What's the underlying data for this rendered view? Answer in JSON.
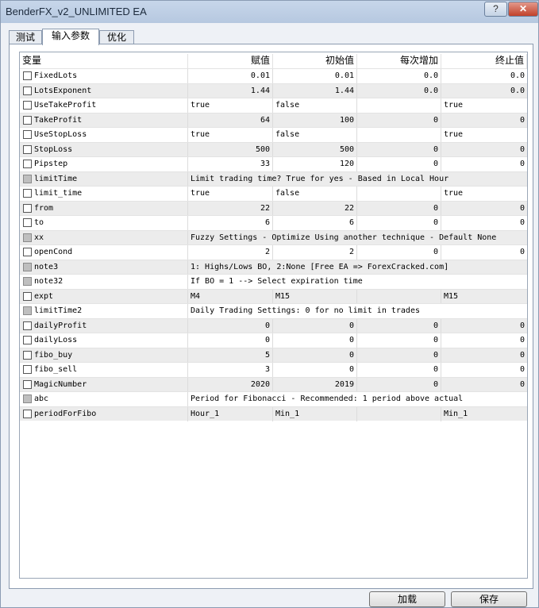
{
  "window": {
    "title": "BenderFX_v2_UNLIMITED EA",
    "help": "?",
    "close": "✕"
  },
  "tabs": [
    {
      "label": "测试"
    },
    {
      "label": "输入参数"
    },
    {
      "label": "优化"
    }
  ],
  "table": {
    "headers": {
      "variable": "变量",
      "value": "赋值",
      "start": "初始值",
      "step": "每次增加",
      "stop": "终止值"
    },
    "rows": [
      {
        "name": "FixedLots",
        "value": "0.01",
        "start": "0.01",
        "step": "0.0",
        "stop": "0.0"
      },
      {
        "name": "LotsExponent",
        "value": "1.44",
        "start": "1.44",
        "step": "0.0",
        "stop": "0.0"
      },
      {
        "name": "UseTakeProfit",
        "value": "true",
        "start": "false",
        "step": "",
        "stop": "true"
      },
      {
        "name": "TakeProfit",
        "value": "64",
        "start": "100",
        "step": "0",
        "stop": "0"
      },
      {
        "name": "UseStopLoss",
        "value": "true",
        "start": "false",
        "step": "",
        "stop": "true"
      },
      {
        "name": "StopLoss",
        "value": "500",
        "start": "500",
        "step": "0",
        "stop": "0"
      },
      {
        "name": "Pipstep",
        "value": "33",
        "start": "120",
        "step": "0",
        "stop": "0"
      },
      {
        "name": "limitTime",
        "note": "Limit trading time? True for yes - Based in Local Hour"
      },
      {
        "name": "limit_time",
        "value": "true",
        "start": "false",
        "step": "",
        "stop": "true"
      },
      {
        "name": "from",
        "value": "22",
        "start": "22",
        "step": "0",
        "stop": "0"
      },
      {
        "name": "to",
        "value": "6",
        "start": "6",
        "step": "0",
        "stop": "0"
      },
      {
        "name": "xx",
        "note": "Fuzzy Settings - Optimize Using another technique - Default None"
      },
      {
        "name": "openCond",
        "value": "2",
        "start": "2",
        "step": "0",
        "stop": "0"
      },
      {
        "name": "note3",
        "note": "1: Highs/Lows BO, 2:None [Free EA => ForexCracked.com]"
      },
      {
        "name": "note32",
        "note": "If BO = 1 --> Select expiration time"
      },
      {
        "name": "expt",
        "value": "M4",
        "start": "M15",
        "step": "",
        "stop": "M15"
      },
      {
        "name": "limitTime2",
        "note": "Daily Trading Settings: 0 for no limit in trades"
      },
      {
        "name": "dailyProfit",
        "value": "0",
        "start": "0",
        "step": "0",
        "stop": "0"
      },
      {
        "name": "dailyLoss",
        "value": "0",
        "start": "0",
        "step": "0",
        "stop": "0"
      },
      {
        "name": "fibo_buy",
        "value": "5",
        "start": "0",
        "step": "0",
        "stop": "0"
      },
      {
        "name": "fibo_sell",
        "value": "3",
        "start": "0",
        "step": "0",
        "stop": "0"
      },
      {
        "name": "MagicNumber",
        "value": "2020",
        "start": "2019",
        "step": "0",
        "stop": "0"
      },
      {
        "name": "abc",
        "note": "Period for Fibonacci - Recommended: 1 period above actual"
      },
      {
        "name": "periodForFibo",
        "value": "Hour_1",
        "start": "Min_1",
        "step": "",
        "stop": "Min_1"
      }
    ]
  },
  "buttons": {
    "load": "加载",
    "save": "保存"
  }
}
